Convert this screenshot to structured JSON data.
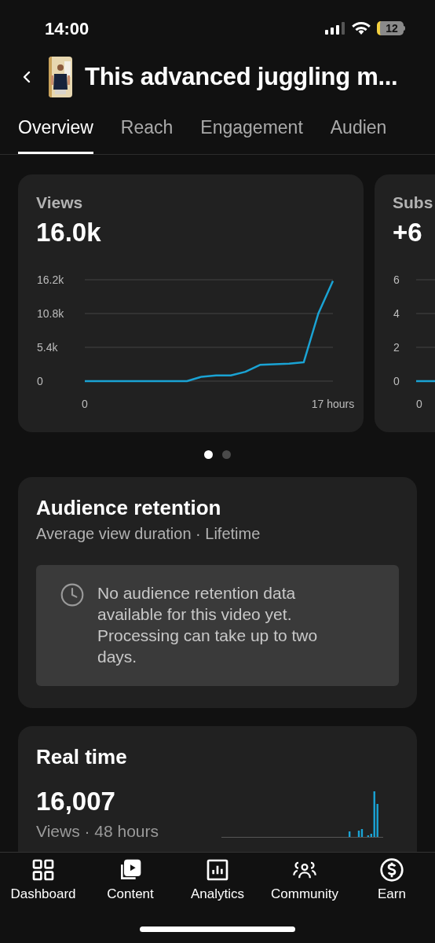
{
  "status_bar": {
    "time": "14:00",
    "battery": "12"
  },
  "header": {
    "title": "This advanced juggling m..."
  },
  "tabs": [
    {
      "label": "Overview",
      "selected": true
    },
    {
      "label": "Reach",
      "selected": false
    },
    {
      "label": "Engagement",
      "selected": false
    },
    {
      "label": "Audien",
      "selected": false
    }
  ],
  "metric_cards": [
    {
      "title": "Views",
      "value": "16.0k",
      "chart_data": {
        "type": "line",
        "x": [
          0,
          1,
          2,
          3,
          4,
          5,
          6,
          7,
          8,
          9,
          10,
          11,
          12,
          13,
          14,
          15,
          16,
          17
        ],
        "series": [
          {
            "color": "#1aa3d4",
            "values": [
              0,
              0,
              0,
              0,
              0,
              0,
              0,
              0,
              700,
              900,
              900,
              1500,
              2600,
              2700,
              2800,
              3000,
              10800,
              16000
            ]
          }
        ],
        "xlim": [
          0,
          17
        ],
        "ylim": [
          0,
          16200
        ],
        "xticks": [
          {
            "value": 0,
            "label": "0"
          },
          {
            "value": 17,
            "label": "17 hours"
          }
        ],
        "yticks": [
          {
            "value": 0,
            "label": "0"
          },
          {
            "value": 5400,
            "label": "5.4k"
          },
          {
            "value": 10800,
            "label": "10.8k"
          },
          {
            "value": 16200,
            "label": "16.2k"
          }
        ]
      }
    },
    {
      "title": "Subs",
      "value": "+6",
      "y_labels": [
        "6",
        "4",
        "2",
        "0"
      ],
      "x_label": "0"
    }
  ],
  "pager": [
    {
      "selected": true
    },
    {
      "selected": false
    }
  ],
  "retention": {
    "title": "Audience retention",
    "subtitle": "Average view duration · Lifetime",
    "notice": "No audience retention data available for this video yet. Processing can take up to two days."
  },
  "real_time": {
    "title": "Real time",
    "value": "16,007",
    "caption": "Views · 48 hours"
  },
  "bottom_nav": [
    {
      "label": "Dashboard"
    },
    {
      "label": "Content"
    },
    {
      "label": "Analytics"
    },
    {
      "label": "Community"
    },
    {
      "label": "Earn"
    }
  ]
}
